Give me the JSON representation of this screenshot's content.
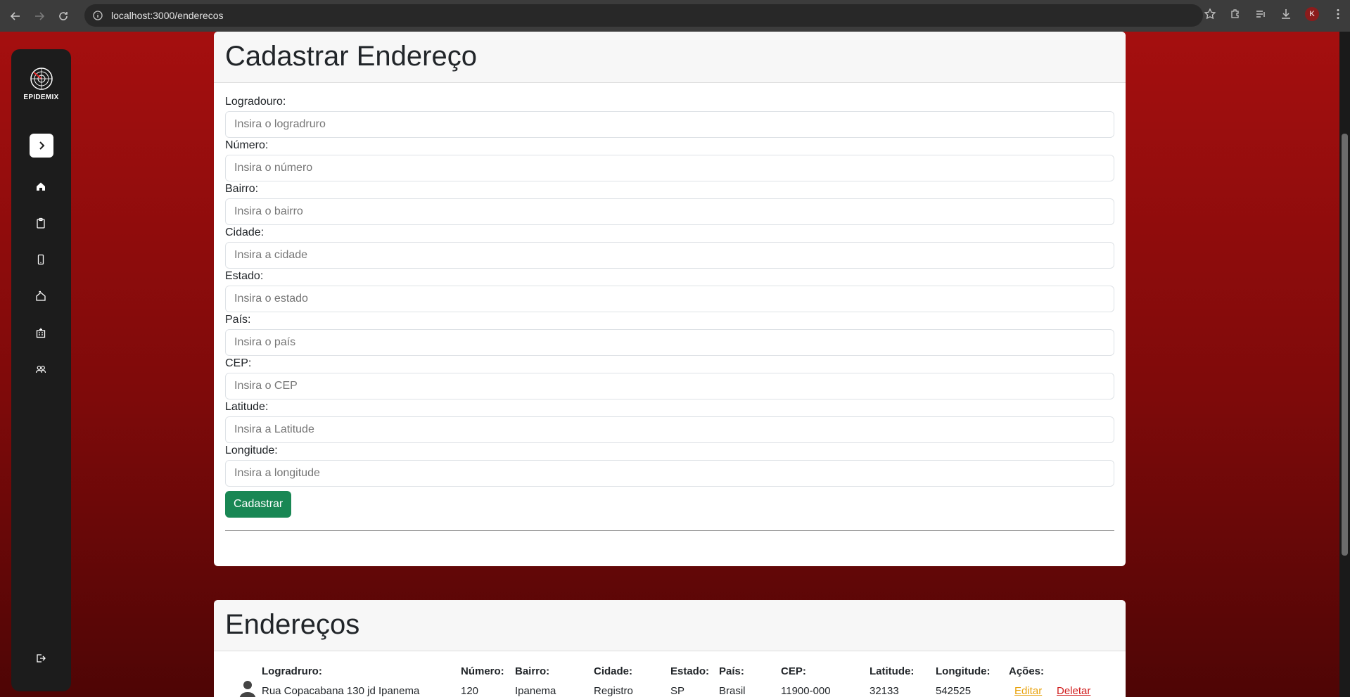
{
  "browser": {
    "url": "localhost:3000/enderecos",
    "profile_initial": "K"
  },
  "sidebar": {
    "logo_text": "EPIDEMIX",
    "items": [
      {
        "icon": "home-icon"
      },
      {
        "icon": "clipboard-icon"
      },
      {
        "icon": "phone-icon"
      },
      {
        "icon": "house-icon"
      },
      {
        "icon": "hospital-icon"
      },
      {
        "icon": "users-icon"
      }
    ],
    "logout_icon": "logout-icon"
  },
  "form": {
    "title": "Cadastrar Endereço",
    "fields": [
      {
        "label": "Logradouro:",
        "placeholder": "Insira o logradruro",
        "value": ""
      },
      {
        "label": "Número:",
        "placeholder": "Insira o número",
        "value": ""
      },
      {
        "label": "Bairro:",
        "placeholder": "Insira o bairro",
        "value": ""
      },
      {
        "label": "Cidade:",
        "placeholder": "Insira a cidade",
        "value": ""
      },
      {
        "label": "Estado:",
        "placeholder": "Insira o estado",
        "value": ""
      },
      {
        "label": "País:",
        "placeholder": "Insira o país",
        "value": ""
      },
      {
        "label": "CEP:",
        "placeholder": "Insira o CEP",
        "value": ""
      },
      {
        "label": "Latitude:",
        "placeholder": "Insira a Latitude",
        "value": ""
      },
      {
        "label": "Longitude:",
        "placeholder": "Insira a longitude",
        "value": ""
      }
    ],
    "submit_label": "Cadastrar"
  },
  "list": {
    "title": "Endereços",
    "headers": [
      "Logradruro:",
      "Número:",
      "Bairro:",
      "Cidade:",
      "Estado:",
      "País:",
      "CEP:",
      "Latitude:",
      "Longitude:",
      "Ações:"
    ],
    "rows": [
      {
        "logradouro": "Rua Copacabana 130 jd Ipanema",
        "numero": "120",
        "bairro": "Ipanema",
        "cidade": "Registro",
        "estado": "SP",
        "pais": "Brasil",
        "cep": "11900-000",
        "latitude": "32133",
        "longitude": "542525",
        "edit_label": "Editar",
        "delete_label": "Deletar"
      }
    ]
  },
  "colors": {
    "primary_bg": "#a50f0f",
    "submit": "#198754",
    "edit": "#e8a20c",
    "delete": "#d01b1b"
  }
}
